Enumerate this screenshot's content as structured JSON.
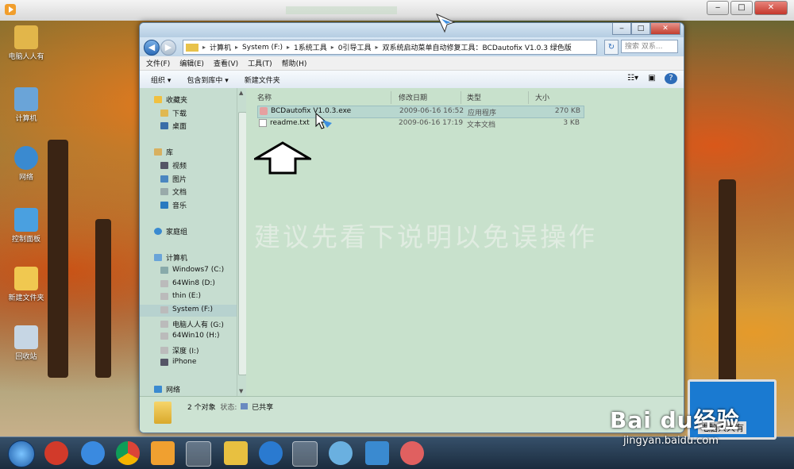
{
  "player": {
    "min": "‒",
    "max": "□",
    "close": "✕"
  },
  "desktop_icons": [
    {
      "label": "电脑人人有",
      "color": "#e2b64a"
    },
    {
      "label": "计算机",
      "color": "#6aa4d8"
    },
    {
      "label": "网络",
      "color": "#3a8ad0"
    },
    {
      "label": "控制面板",
      "color": "#4aa0e0"
    },
    {
      "label": "新建文件夹",
      "color": "#f0c850"
    },
    {
      "label": "回收站",
      "color": "#c6d6e4"
    }
  ],
  "window": {
    "address": [
      "计算机",
      "System (F:)",
      "1系统工具",
      "0引导工具",
      "双系统启动菜单自动修复工具：BCDautofix V1.0.3 绿色版"
    ],
    "search_placeholder": "搜索 双系...",
    "menu": [
      "文件(F)",
      "编辑(E)",
      "查看(V)",
      "工具(T)",
      "帮助(H)"
    ],
    "toolbar": {
      "organize": "组织 ▾",
      "include": "包含到库中 ▾",
      "new_folder": "新建文件夹"
    },
    "nav": {
      "favorites": "收藏夹",
      "fav_items": [
        "下载",
        "桌面"
      ],
      "libraries": "库",
      "lib_items": [
        "视频",
        "图片",
        "文档",
        "音乐"
      ],
      "homegroup": "家庭组",
      "computer": "计算机",
      "drives": [
        "Windows7 (C:)",
        "64Win8 (D:)",
        "thin (E:)",
        "System (F:)",
        "电脑人人有 (G:)",
        "64Win10 (H:)",
        "深度 (I:)",
        "iPhone"
      ],
      "network": "网络"
    },
    "columns": {
      "name": "名称",
      "date": "修改日期",
      "type": "类型",
      "size": "大小"
    },
    "files": [
      {
        "name": "BCDautofix V1.0.3.exe",
        "date": "2009-06-16 16:52",
        "type": "应用程序",
        "size": "270 KB"
      },
      {
        "name": "readme.txt",
        "date": "2009-06-16 17:19",
        "type": "文本文档",
        "size": "3 KB"
      }
    ],
    "watermark": "建议先看下说明以免误操作",
    "details": {
      "count": "2 个对象",
      "state_label": "状态:",
      "state_value": "已共享"
    }
  },
  "branding": {
    "baidu": "Bai du经验",
    "url": "jingyan.baidu.com",
    "laptop_text": "电脑人人有"
  }
}
